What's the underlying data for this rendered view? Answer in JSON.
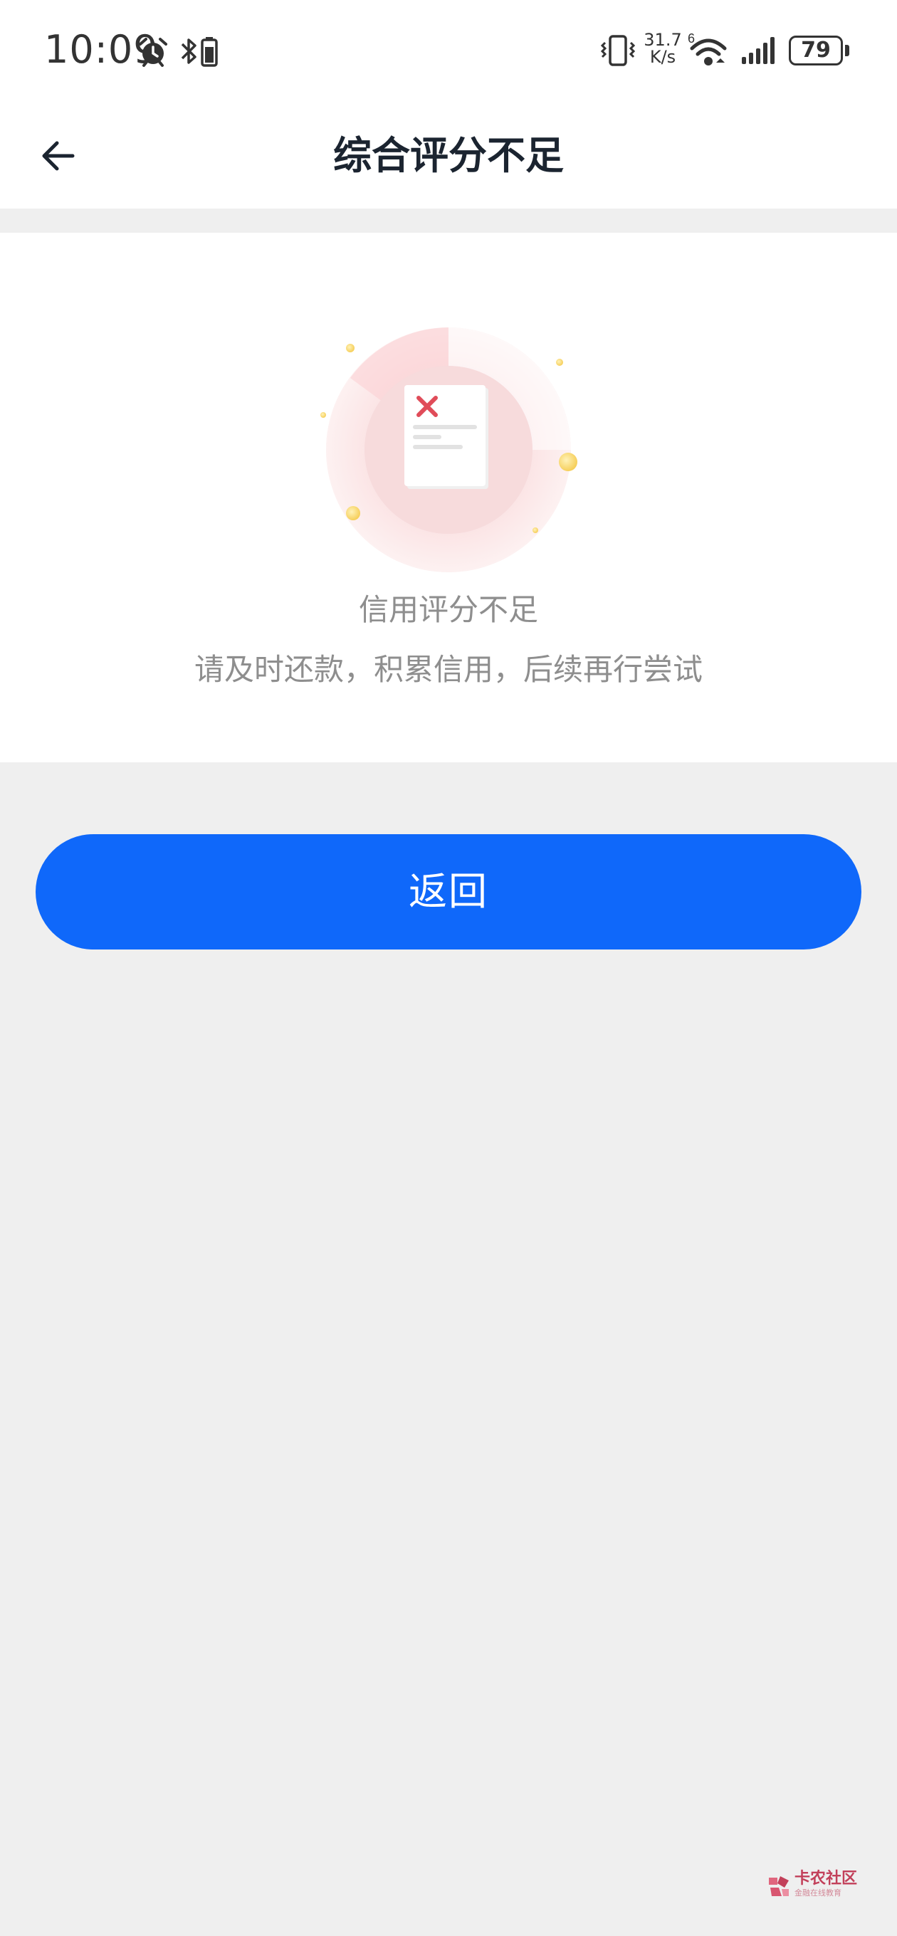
{
  "status_bar": {
    "time": "10:09",
    "net_speed_value": "31.7",
    "net_speed_unit": "K/s",
    "wifi_badge": "6",
    "battery": "79",
    "icons": [
      "alarm-icon",
      "bluetooth-icon",
      "vibrate-icon",
      "wifi-icon",
      "signal-icon",
      "battery-icon"
    ]
  },
  "nav": {
    "title": "综合评分不足",
    "back_icon": "back-arrow-icon"
  },
  "result": {
    "illustration_icon": "rejected-document-icon",
    "title": "信用评分不足",
    "description": "请及时还款，积累信用，后续再行尝试"
  },
  "actions": {
    "return_label": "返回"
  },
  "watermark": {
    "text": "卡农社区",
    "subtext": "金融在线教育"
  },
  "colors": {
    "primary": "#0f68fa",
    "page_background": "#efefef",
    "title_text": "#1b2430",
    "muted_text": "#8e8e8e",
    "error_red": "#e24a5a"
  }
}
